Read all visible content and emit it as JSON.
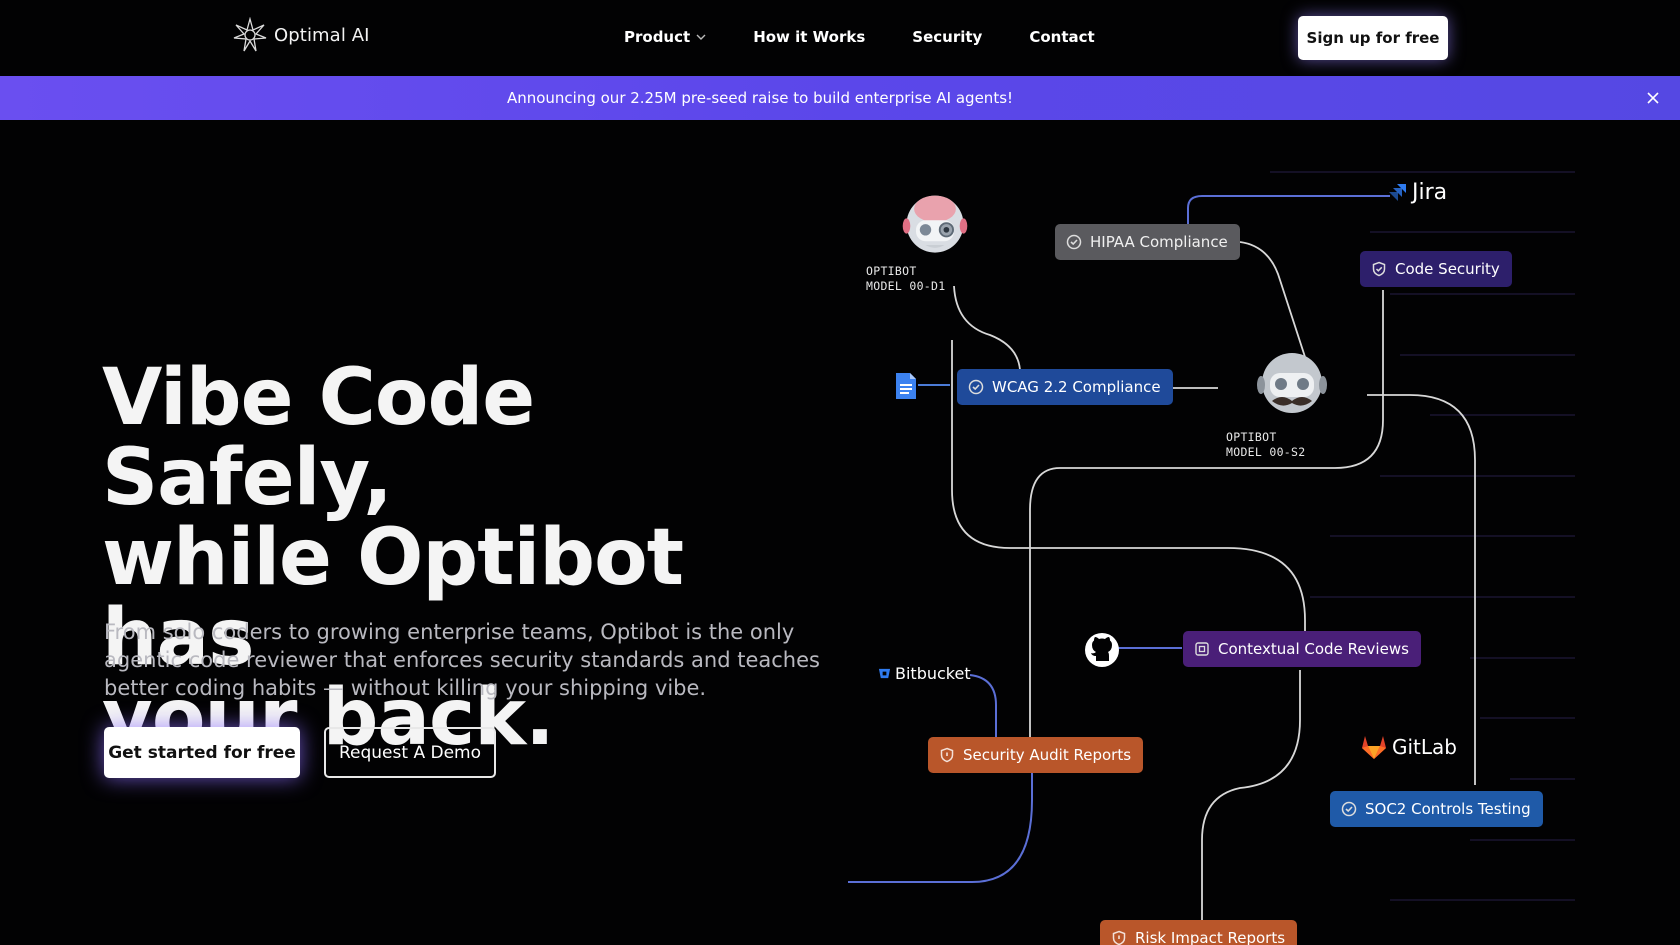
{
  "nav": {
    "brand": "Optimal AI",
    "links": [
      {
        "label": "Product",
        "has_dropdown": true
      },
      {
        "label": "How it Works"
      },
      {
        "label": "Security"
      },
      {
        "label": "Contact"
      }
    ],
    "signup_label": "Sign up for free"
  },
  "banner": {
    "text": "Announcing our 2.25M pre-seed raise to build enterprise AI agents!"
  },
  "hero": {
    "title_line1": "Vibe Code Safely,",
    "title_line2": "while Optibot has",
    "title_line3": "your back.",
    "subtitle": "From solo coders to growing enterprise teams, Optibot is the only agentic code reviewer that enforces security standards and teaches better coding habits — without killing your shipping vibe.",
    "cta_primary": "Get started for free",
    "cta_secondary": "Request A Demo"
  },
  "diagram": {
    "robots": [
      {
        "line1": "OPTIBOT",
        "line2": "MODEL 00-D1"
      },
      {
        "line1": "OPTIBOT",
        "line2": "MODEL 00-S2"
      }
    ],
    "pills": {
      "hipaa": "HIPAA Compliance",
      "code_security": "Code Security",
      "wcag": "WCAG 2.2 Compliance",
      "contextual": "Contextual Code Reviews",
      "security_audit": "Security Audit Reports",
      "soc2": "SOC2 Controls Testing",
      "risk": "Risk Impact Reports"
    },
    "integrations": {
      "jira": "Jira",
      "bitbucket": "Bitbucket",
      "gitlab": "GitLab"
    }
  },
  "colors": {
    "banner": "#5b47ea",
    "background": "#020203",
    "accent_glow": "#8c6eff"
  }
}
